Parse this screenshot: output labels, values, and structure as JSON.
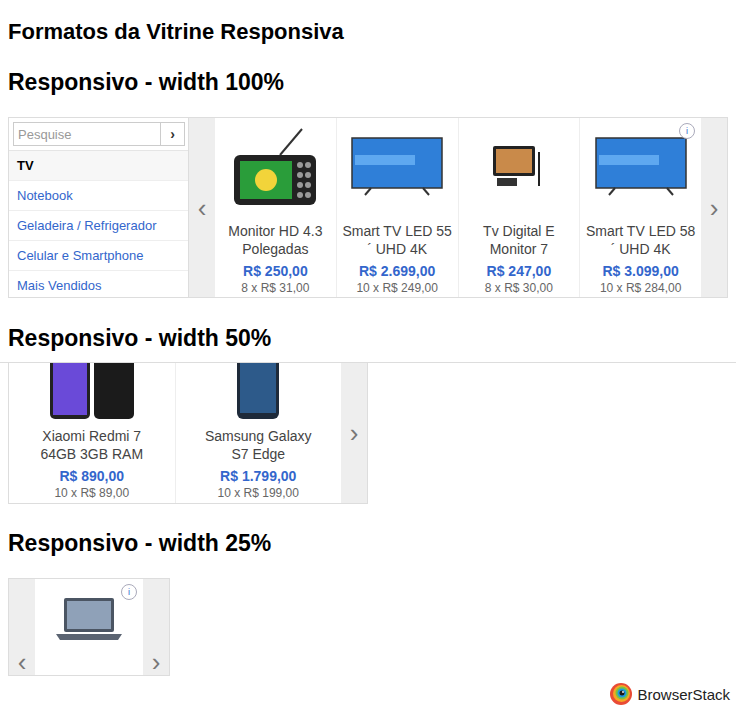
{
  "page": {
    "title": "Formatos da Vitrine Responsiva"
  },
  "sections": [
    {
      "heading": "Responsivo - width 100%",
      "kind": "full",
      "sidebar": {
        "search": {
          "placeholder": "Pesquise",
          "button": "›"
        },
        "items": [
          {
            "label": "TV",
            "selected": true
          },
          {
            "label": "Notebook",
            "selected": false
          },
          {
            "label": "Geladeira / Refrigerador",
            "selected": false
          },
          {
            "label": "Celular e Smartphone",
            "selected": false
          },
          {
            "label": "Mais Vendidos",
            "selected": false
          }
        ]
      },
      "arrows": {
        "prev": "‹",
        "next": "›"
      },
      "products": [
        {
          "name": "Monitor HD 4.3 Polegadas",
          "price": "R$ 250,00",
          "installments": "8 x R$ 31,00",
          "image": "mini-tv",
          "badge": ""
        },
        {
          "name": "Smart TV LED 55 ´ UHD 4K",
          "price": "R$ 2.699,00",
          "installments": "10 x R$ 249,00",
          "image": "tv",
          "badge": ""
        },
        {
          "name": "Tv Digital E Monitor 7",
          "price": "R$ 247,00",
          "installments": "8 x R$ 30,00",
          "image": "tablet",
          "badge": ""
        },
        {
          "name": "Smart TV LED 58 ´ UHD 4K",
          "price": "R$ 3.099,00",
          "installments": "10 x R$ 284,00",
          "image": "tv",
          "badge": "i"
        }
      ]
    },
    {
      "heading": "Responsivo - width 50%",
      "kind": "half",
      "arrows": {
        "next": "›"
      },
      "products": [
        {
          "name": "Xiaomi Redmi 7 64GB 3GB RAM",
          "price": "R$ 890,00",
          "installments": "10 x R$ 89,00",
          "image": "phones",
          "badge": ""
        },
        {
          "name": "Samsung Galaxy S7 Edge",
          "price": "R$ 1.799,00",
          "installments": "10 x R$ 199,00",
          "image": "phone",
          "badge": ""
        }
      ]
    },
    {
      "heading": "Responsivo - width 25%",
      "kind": "quarter",
      "arrows": {
        "prev": "‹",
        "next": "›"
      },
      "products": [
        {
          "name": "",
          "price": "",
          "installments": "",
          "image": "laptop",
          "badge": "i"
        }
      ]
    }
  ],
  "watermark": {
    "text": "BrowserStack"
  }
}
